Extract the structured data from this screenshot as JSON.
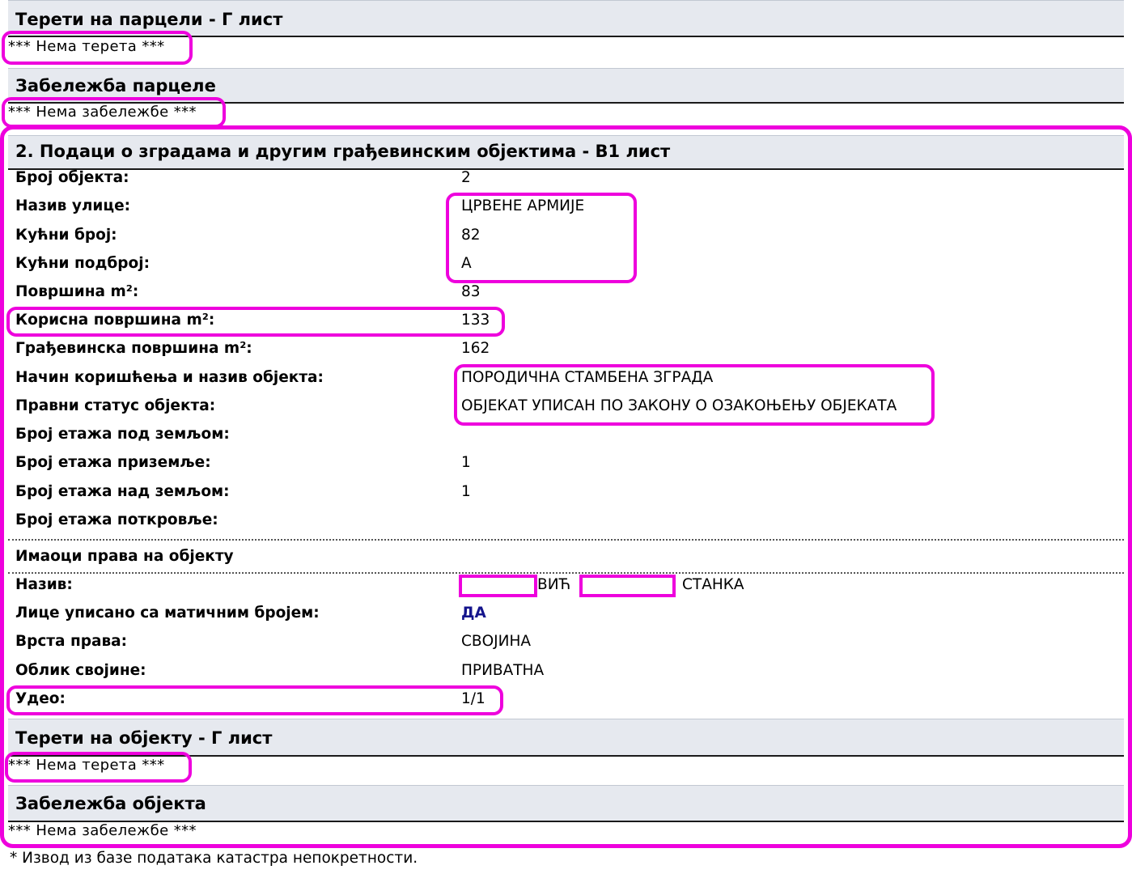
{
  "parcel_burdens": {
    "title": "Терети на парцели - Г лист",
    "empty": "*** Нема терета ***"
  },
  "parcel_notes": {
    "title": "Забележба парцеле",
    "empty": "*** Нема забележбе ***"
  },
  "buildings_section": {
    "title": "2. Подаци о зградама и другим грађевинским објектима - В1 лист",
    "rows": [
      {
        "label": "Број објекта:",
        "value": "2"
      },
      {
        "label": "Назив улице:",
        "value": "ЦРВЕНЕ АРМИЈЕ"
      },
      {
        "label": "Кућни број:",
        "value": "82"
      },
      {
        "label": "Кућни подброј:",
        "value": "А"
      },
      {
        "label": "Површина m²:",
        "value": "83"
      },
      {
        "label": "Корисна површина m²:",
        "value": "133"
      },
      {
        "label": "Грађевинска површина m²:",
        "value": "162"
      },
      {
        "label": "Начин коришћења и назив објекта:",
        "value": "ПОРОДИЧНА СТАМБЕНА ЗГРАДА"
      },
      {
        "label": "Правни статус објекта:",
        "value": "ОБЈЕКАТ УПИСАН ПО ЗАКОНУ О ОЗАКОЊЕЊУ ОБЈЕКАТА"
      },
      {
        "label": "Број етажа под земљом:",
        "value": ""
      },
      {
        "label": "Број етажа приземље:",
        "value": "1"
      },
      {
        "label": "Број етажа над земљом:",
        "value": "1"
      },
      {
        "label": "Број етажа поткровље:",
        "value": ""
      }
    ]
  },
  "owners": {
    "title": "Имаоци права на објекту",
    "name_label": "Назив:",
    "name_part1": "ВИЋ",
    "name_part2": "СТАНКА",
    "rows": [
      {
        "label": "Лице уписано са матичним бројем:",
        "value": "ДА"
      },
      {
        "label": "Врста права:",
        "value": "СВОЈИНА"
      },
      {
        "label": "Облик својине:",
        "value": "ПРИВАТНА"
      },
      {
        "label": "Удео:",
        "value": "1/1"
      }
    ]
  },
  "building_burdens": {
    "title": "Терети на објекту - Г лист",
    "empty": "*** Нема терета ***"
  },
  "building_notes": {
    "title": "Забележба објекта",
    "empty": "*** Нема забележбе ***"
  },
  "footer": "* Извод из базе података катастра непокретности.",
  "colors": {
    "highlight": "#ee00dd",
    "header_band": "#e6e9ef",
    "yes_value": "#14148c"
  }
}
